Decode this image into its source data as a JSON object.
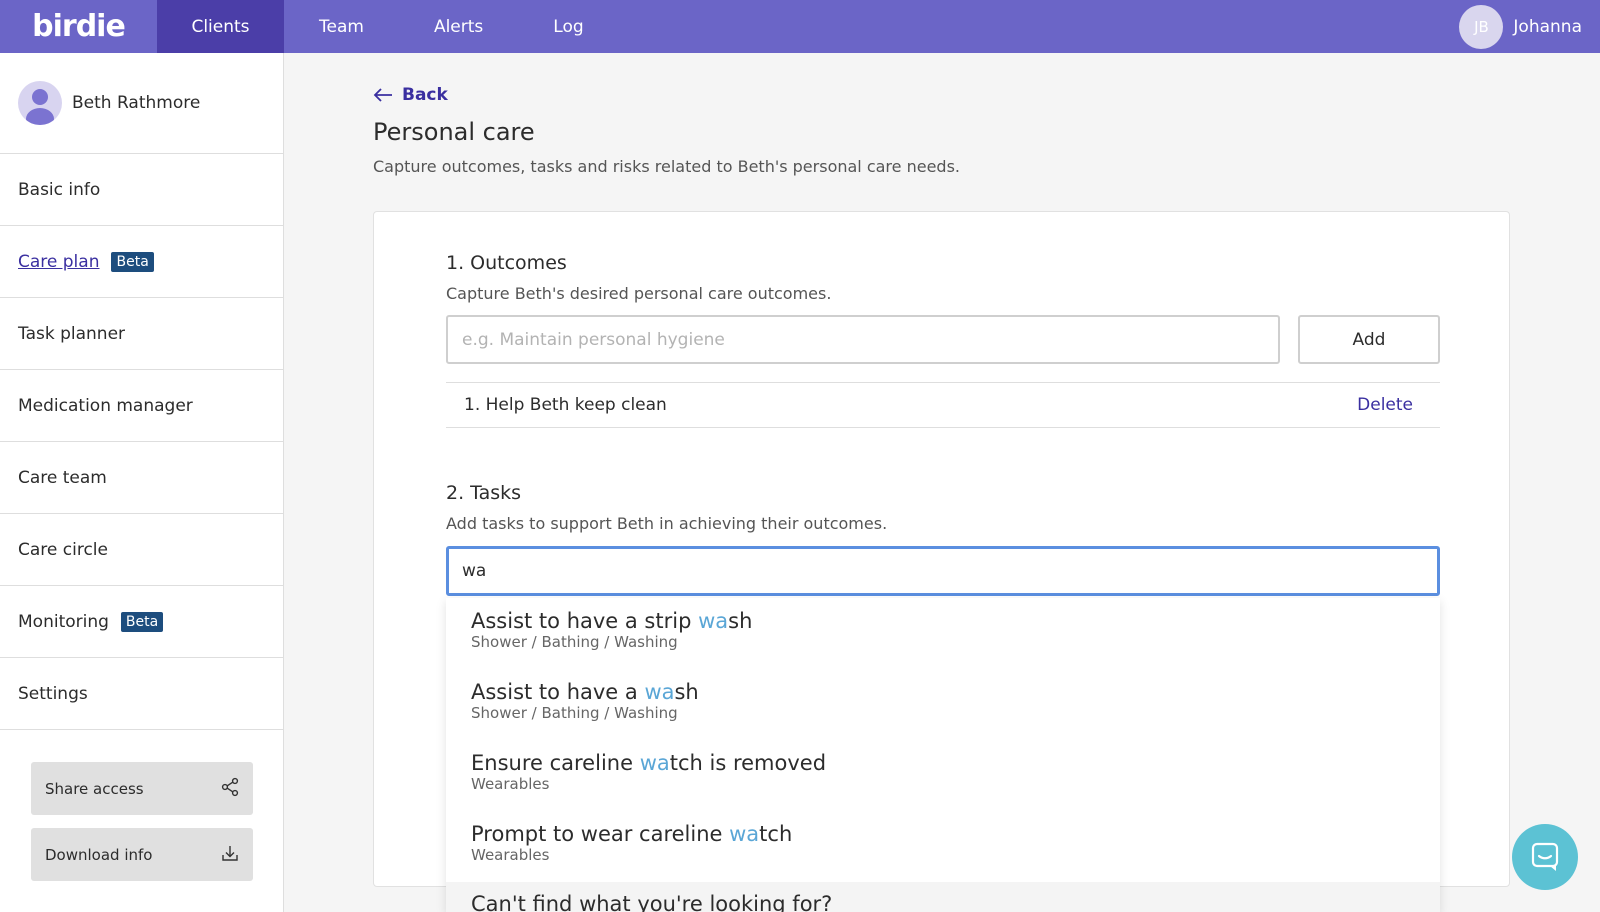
{
  "app": {
    "logo": "birdie",
    "nav": [
      "Clients",
      "Team",
      "Alerts",
      "Log"
    ],
    "user": {
      "initials": "JB",
      "name": "Johanna"
    }
  },
  "sidebar": {
    "client_name": "Beth Rathmore",
    "items": [
      {
        "label": "Basic info"
      },
      {
        "label": "Care plan",
        "badge": "Beta"
      },
      {
        "label": "Task planner"
      },
      {
        "label": "Medication manager"
      },
      {
        "label": "Care team"
      },
      {
        "label": "Care circle"
      },
      {
        "label": "Monitoring",
        "badge": "Beta"
      },
      {
        "label": "Settings"
      }
    ],
    "share_label": "Share access",
    "download_label": "Download info"
  },
  "main": {
    "back_label": "Back",
    "title": "Personal care",
    "subtitle": "Capture outcomes, tasks and risks related to Beth's personal care needs.",
    "outcomes": {
      "title": "1. Outcomes",
      "subtitle": "Capture Beth's desired personal care outcomes.",
      "placeholder": "e.g. Maintain personal hygiene",
      "add_label": "Add",
      "item": "1. Help Beth keep clean",
      "delete_label": "Delete"
    },
    "tasks": {
      "title": "2. Tasks",
      "subtitle": "Add tasks to support Beth in achieving their outcomes.",
      "value": "wa"
    }
  },
  "dropdown": {
    "options": [
      {
        "pre": "Assist to have a strip ",
        "hl": "wa",
        "post": "sh",
        "category": "Shower / Bathing / Washing"
      },
      {
        "pre": "Assist to have a ",
        "hl": "wa",
        "post": "sh",
        "category": "Shower / Bathing / Washing"
      },
      {
        "pre": "Ensure careline ",
        "hl": "wa",
        "post": "tch is removed",
        "category": "Wearables"
      },
      {
        "pre": "Prompt to wear careline ",
        "hl": "wa",
        "post": "tch",
        "category": "Wearables"
      }
    ],
    "footer": "Can't find what you're looking for?"
  },
  "colors": {
    "nav_bg": "#6b65c7",
    "nav_active": "#4b3ea8",
    "link": "#3a2fa0",
    "badge": "#1d4d7e",
    "highlight": "#5aa6d6",
    "focus_border": "#5b8fe0",
    "chat": "#5cc2d4"
  }
}
